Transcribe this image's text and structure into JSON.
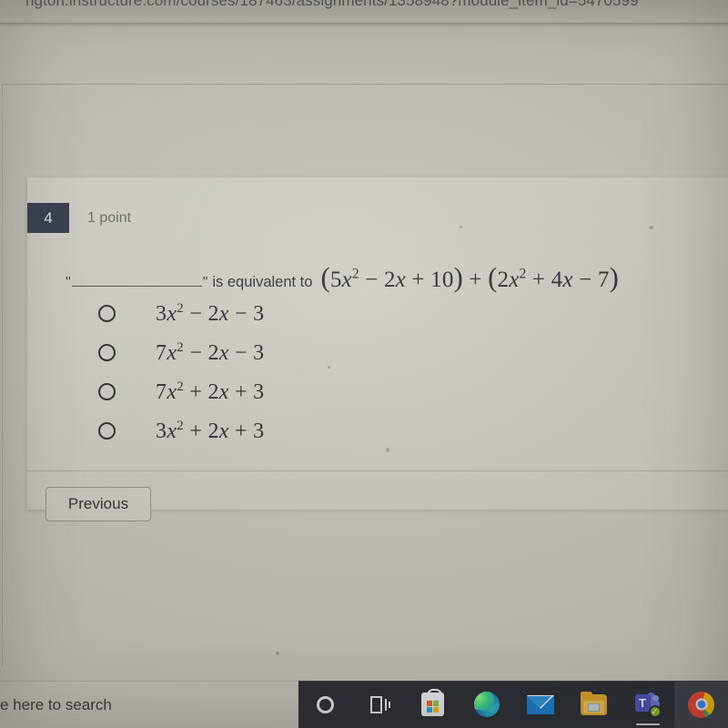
{
  "browser": {
    "url": "ngton.instructure.com/courses/187463/assignments/1358948?module_item_id=5470599"
  },
  "question": {
    "number": "4",
    "points_label": "1 point",
    "quote_open": "\"",
    "quote_close": "\"",
    "prompt_text": "is equivalent to",
    "expression": "(5x² − 2x + 10) + (2x² + 4x − 7)",
    "expression_parts": {
      "group1": "5x² − 2x + 10",
      "operator": "+",
      "group2": "2x² + 4x − 7"
    },
    "options": [
      {
        "id": "a",
        "text": "3x² − 2x − 3",
        "selected": false
      },
      {
        "id": "b",
        "text": "7x² − 2x − 3",
        "selected": false
      },
      {
        "id": "c",
        "text": "7x² + 2x + 3",
        "selected": false
      },
      {
        "id": "d",
        "text": "3x² + 2x + 3",
        "selected": false
      }
    ],
    "previous_button_label": "Previous"
  },
  "taskbar": {
    "search_placeholder": "e here to search",
    "items": [
      {
        "icon": "cortana-icon",
        "label": "Cortana",
        "active": false
      },
      {
        "icon": "task-view-icon",
        "label": "Task View",
        "active": false
      },
      {
        "icon": "microsoft-store-icon",
        "label": "Microsoft Store",
        "active": false
      },
      {
        "icon": "edge-icon",
        "label": "Microsoft Edge",
        "active": false
      },
      {
        "icon": "mail-icon",
        "label": "Mail",
        "active": false
      },
      {
        "icon": "file-explorer-icon",
        "label": "File Explorer",
        "active": false
      },
      {
        "icon": "teams-icon",
        "label": "Microsoft Teams",
        "active": false
      },
      {
        "icon": "chrome-icon",
        "label": "Google Chrome",
        "active": true
      }
    ],
    "teams_badge": "✓",
    "teams_letter": "T"
  },
  "colors": {
    "badge_navy": "#2f3748",
    "card_background": "#cdc9c1",
    "page_background": "#c6c2ba",
    "taskbar_background": "#2b2f35",
    "text_dark": "#2c2b31",
    "text_muted": "#6c6a68"
  }
}
